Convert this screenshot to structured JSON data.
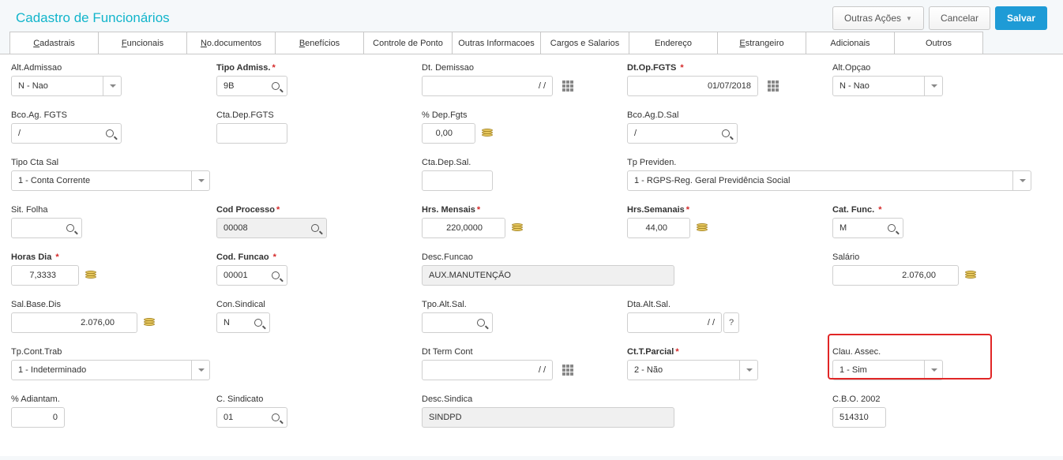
{
  "title_text": "Cadastro de Funcionários",
  "header": {
    "other_actions": "Outras Ações",
    "cancel": "Cancelar",
    "save": "Salvar"
  },
  "tabs": [
    {
      "u": "C",
      "rest": "adastrais"
    },
    {
      "u": "F",
      "rest": "uncionais"
    },
    {
      "u": "N",
      "rest": "o.documentos"
    },
    {
      "u": "B",
      "rest": "enefícios"
    },
    {
      "u": "",
      "rest": "Controle de Ponto"
    },
    {
      "u": "",
      "rest": "Outras Informacoes"
    },
    {
      "u": "",
      "rest": "Cargos e Salarios"
    },
    {
      "u": "",
      "rest": "Endereço"
    },
    {
      "u": "E",
      "rest": "strangeiro"
    },
    {
      "u": "",
      "rest": "Adicionais"
    },
    {
      "u": "",
      "rest": "Outros"
    }
  ],
  "active_tab_index": 1,
  "fields": {
    "alt_admissao": {
      "label": "Alt.Admissao",
      "value": "N - Nao"
    },
    "tipo_admiss": {
      "label": "Tipo Admiss.",
      "value": "9B"
    },
    "dt_demissao": {
      "label": "Dt. Demissao",
      "value": "  / /"
    },
    "dt_op_fgts": {
      "label": "Dt.Op.FGTS",
      "value": "01/07/2018"
    },
    "alt_opcao": {
      "label": "Alt.Opçao",
      "value": "N - Nao"
    },
    "bco_ag_fgts": {
      "label": "Bco.Ag. FGTS",
      "value": "/"
    },
    "cta_dep_fgts": {
      "label": "Cta.Dep.FGTS",
      "value": ""
    },
    "pct_dep_fgts": {
      "label": "% Dep.Fgts",
      "value": "0,00"
    },
    "bco_ag_d_sal": {
      "label": "Bco.Ag.D.Sal",
      "value": "/"
    },
    "tipo_cta_sal": {
      "label": "Tipo Cta Sal",
      "value": "1 - Conta Corrente"
    },
    "cta_dep_sal": {
      "label": "Cta.Dep.Sal.",
      "value": ""
    },
    "tp_previden": {
      "label": "Tp Previden.",
      "value": "1 - RGPS-Reg. Geral Previdência Social"
    },
    "sit_folha": {
      "label": "Sit. Folha",
      "value": ""
    },
    "cod_processo": {
      "label": "Cod Processo",
      "value": "00008"
    },
    "hrs_mensais": {
      "label": "Hrs. Mensais",
      "value": "220,0000"
    },
    "hrs_semanais": {
      "label": "Hrs.Semanais",
      "value": "44,00"
    },
    "cat_func": {
      "label": "Cat. Func.",
      "value": "M"
    },
    "horas_dia": {
      "label": "Horas Dia",
      "value": "7,3333"
    },
    "cod_funcao": {
      "label": "Cod. Funcao",
      "value": "00001"
    },
    "desc_funcao": {
      "label": "Desc.Funcao",
      "value": "AUX.MANUTENÇÃO"
    },
    "salario": {
      "label": "Salário",
      "value": "2.076,00"
    },
    "sal_base_dis": {
      "label": "Sal.Base.Dis",
      "value": "2.076,00"
    },
    "con_sindical": {
      "label": "Con.Sindical",
      "value": "N"
    },
    "tpo_alt_sal": {
      "label": "Tpo.Alt.Sal.",
      "value": ""
    },
    "dta_alt_sal": {
      "label": "Dta.Alt.Sal.",
      "value": "  / /"
    },
    "tp_cont_trab": {
      "label": "Tp.Cont.Trab",
      "value": "1 - Indeterminado"
    },
    "dt_term_cont": {
      "label": "Dt Term Cont",
      "value": "  / /"
    },
    "ct_t_parcial": {
      "label": "Ct.T.Parcial",
      "value": "2 - Não"
    },
    "clau_assec": {
      "label": "Clau. Assec.",
      "value": "1 - Sim"
    },
    "pct_adiantam": {
      "label": "% Adiantam.",
      "value": "0"
    },
    "c_sindicato": {
      "label": "C. Sindicato",
      "value": "01"
    },
    "desc_sindica": {
      "label": "Desc.Sindica",
      "value": "SINDPD"
    },
    "cbo_2002": {
      "label": "C.B.O. 2002",
      "value": "514310"
    }
  }
}
